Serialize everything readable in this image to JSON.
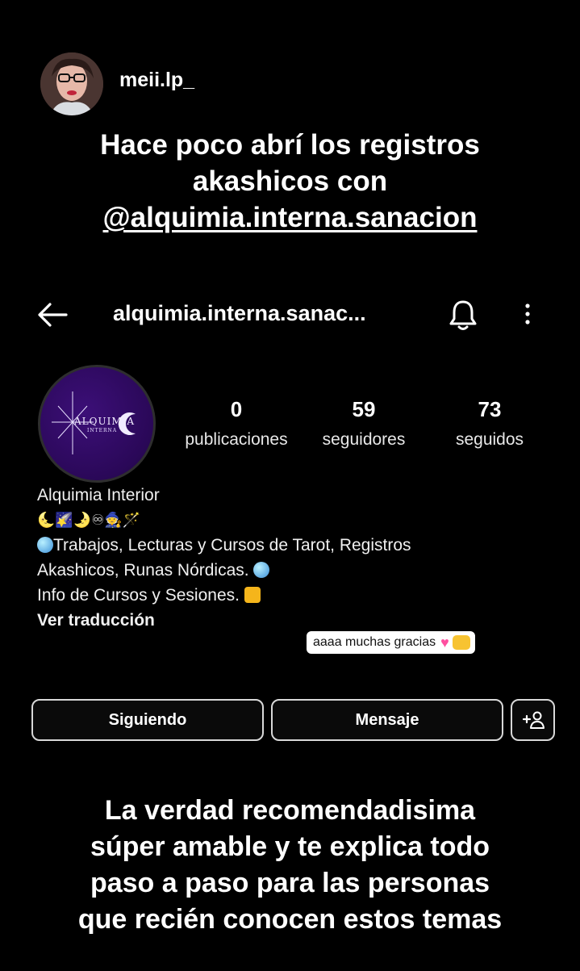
{
  "story": {
    "username": "meii.lp_",
    "caption_top": [
      "Hace poco abrí los registros",
      "akashicos con"
    ],
    "caption_mention": "@alquimia.interna.sanacion",
    "caption_bottom": [
      "La verdad recomendadisima",
      "súper amable y te explica todo",
      "paso a paso para las personas",
      "que recién conocen estos temas"
    ],
    "sticker_text": "aaaa muchas gracias"
  },
  "profile": {
    "header_title": "alquimia.interna.sanac...",
    "logo_text": "ALQUIMIA",
    "logo_subtext": "INTERNA",
    "stats": {
      "posts": {
        "count": "0",
        "label": "publicaciones"
      },
      "followers": {
        "count": "59",
        "label": "seguidores"
      },
      "following": {
        "count": "73",
        "label": "seguidos"
      }
    },
    "name": "Alquimia Interior",
    "emoji_row": "🌜🌠🌛♾🧙🪄",
    "bio_lines": [
      "Trabajos, Lecturas y Cursos de Tarot, Registros",
      "Akashicos, Runas Nórdicas.",
      "Info de Cursos y Sesiones."
    ],
    "translate_label": "Ver traducción",
    "buttons": {
      "following": "Siguiendo",
      "message": "Mensaje"
    }
  },
  "colors": {
    "background": "#000000",
    "profile_purple": "#2a0858",
    "button_border": "#d8d8d8"
  },
  "icons": [
    "back-arrow-icon",
    "bell-icon",
    "more-options-icon",
    "add-person-icon"
  ]
}
